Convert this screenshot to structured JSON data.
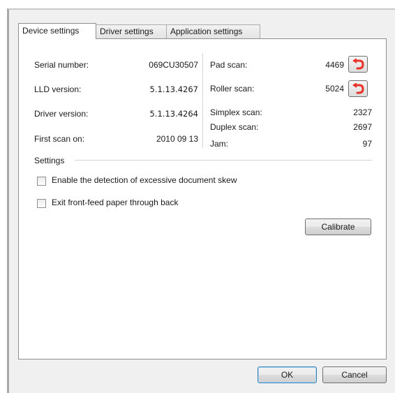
{
  "tabs": [
    "Device settings",
    "Driver settings",
    "Application settings"
  ],
  "device_info": {
    "serial_label": "Serial number:",
    "serial_value": "069CU30507",
    "lld_label": "LLD version:",
    "lld_value": "5.1.13.4267",
    "driver_label": "Driver version:",
    "driver_value": "5.1.13.4264",
    "first_scan_label": "First scan on:",
    "first_scan_value": "2010 09 13"
  },
  "counters": {
    "pad_label": "Pad scan:",
    "pad_value": "4469",
    "roller_label": "Roller scan:",
    "roller_value": "5024",
    "simplex_label": "Simplex scan:",
    "simplex_value": "2327",
    "duplex_label": "Duplex scan:",
    "duplex_value": "2697",
    "jam_label": "Jam:",
    "jam_value": "97"
  },
  "settings": {
    "group_label": "Settings",
    "skew_label": "Enable the detection of excessive document skew",
    "skew_checked": false,
    "exit_label": "Exit front-feed paper through back",
    "exit_checked": false,
    "calibrate_label": "Calibrate"
  },
  "dialog": {
    "ok_label": "OK",
    "cancel_label": "Cancel"
  },
  "icons": {
    "reset": "reset-counter-icon"
  },
  "colors": {
    "reset_arrow": "#e8322a"
  }
}
